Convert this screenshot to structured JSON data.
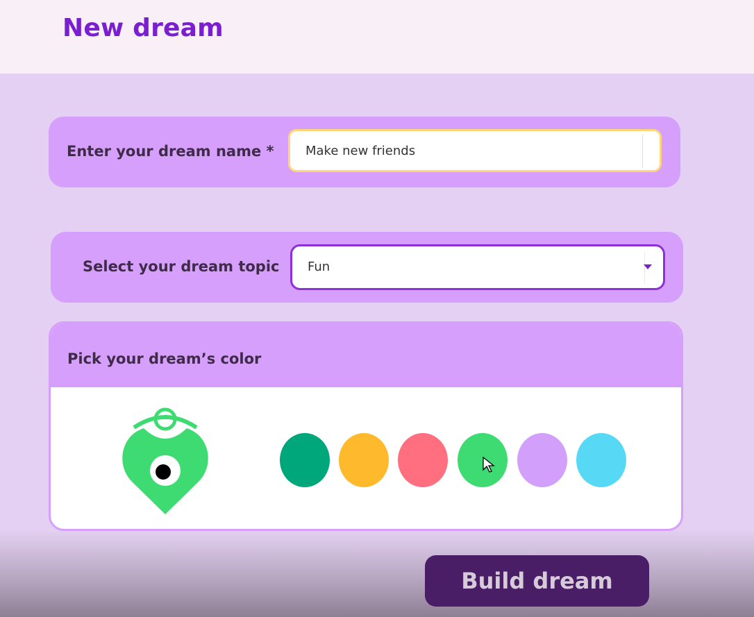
{
  "header": {
    "title": "New dream"
  },
  "name_field": {
    "label": "Enter your dream name *",
    "value": "Make new friends",
    "border_color": "#ffd67a"
  },
  "topic_field": {
    "label": "Select your dream topic",
    "selected": "Fun",
    "caret_icon": "caret-down-icon",
    "border_color": "#8d30d8"
  },
  "color_picker": {
    "label": "Pick your dream’s color",
    "selected_color": "#3ddb72",
    "avatar_icon": "dream-creature-icon",
    "swatches": [
      {
        "color": "#00a77a"
      },
      {
        "color": "#ffb92d"
      },
      {
        "color": "#ff6f80"
      },
      {
        "color": "#3ddb72"
      },
      {
        "color": "#d29ffb"
      },
      {
        "color": "#57d9f6"
      }
    ]
  },
  "actions": {
    "build_label": "Build dream"
  },
  "colors": {
    "accent": "#7a1fd0",
    "card": "#d69ffc",
    "background": "#e3d0f2",
    "button": "#4a1d67"
  }
}
